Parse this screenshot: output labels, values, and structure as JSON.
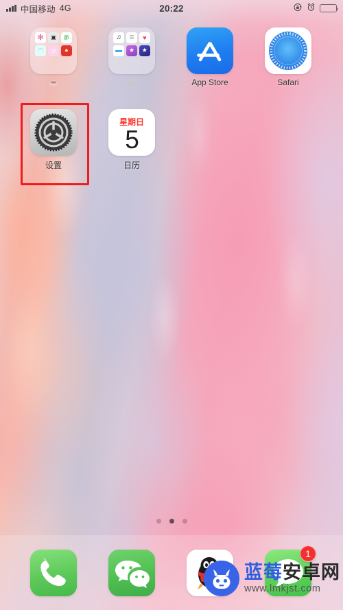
{
  "status_bar": {
    "carrier": "中国移动",
    "network": "4G",
    "time": "20:22",
    "signal_icon": "signal-bars-icon",
    "rotation_lock_icon": "rotation-lock-icon",
    "alarm_icon": "alarm-clock-icon",
    "battery_icon": "battery-full-icon"
  },
  "home_screen": {
    "rows": [
      {
        "items": [
          {
            "type": "folder",
            "name": "folder-photos-camera",
            "label": "",
            "mini_apps": [
              {
                "name": "photos-app",
                "glyph": "❋",
                "bg": "#ffffff",
                "fg": "#e8457c"
              },
              {
                "name": "camera-app",
                "glyph": "📷",
                "bg": "#efefef",
                "fg": "#3a3a3a"
              },
              {
                "name": "chinese-text-app",
                "glyph": "節",
                "bg": "#f4fff6",
                "fg": "#2f9e5a"
              },
              {
                "name": "white-face-app",
                "glyph": "◠",
                "bg": "#e6fbfb",
                "fg": "#6fd0cf"
              },
              {
                "name": "meitu-camera-app",
                "glyph": "⊙",
                "bg": "#ffd9ec",
                "fg": "#ffffff"
              },
              {
                "name": "red-cartoon-app",
                "glyph": "♣",
                "bg": "#e83b3b",
                "fg": "#ffffff"
              }
            ]
          },
          {
            "type": "folder",
            "name": "folder-media-tools",
            "label": "",
            "mini_apps": [
              {
                "name": "music-app",
                "glyph": "♫",
                "bg": "#ffffff",
                "fg": "#3a3a3a"
              },
              {
                "name": "reminders-app",
                "glyph": "☰",
                "bg": "#fbfbfb",
                "fg": "#8a8a8a"
              },
              {
                "name": "health-app",
                "glyph": "♥",
                "bg": "#ffffff",
                "fg": "#f0375a"
              },
              {
                "name": "files-app",
                "glyph": "▭",
                "bg": "#ffffff",
                "fg": "#4aa8ea"
              },
              {
                "name": "imovie-app",
                "glyph": "★",
                "bg": "#a94fd4",
                "fg": "#ffffff"
              },
              {
                "name": "itunes-app",
                "glyph": "★",
                "bg": "#2b2a8e",
                "fg": "#ffffff"
              }
            ]
          },
          {
            "type": "app",
            "name": "app-store",
            "label": "App Store",
            "icon": "app-store-icon"
          },
          {
            "type": "app",
            "name": "safari",
            "label": "Safari",
            "icon": "safari-compass-icon"
          }
        ]
      },
      {
        "items": [
          {
            "type": "app",
            "name": "settings",
            "label": "设置",
            "icon": "gear-icon",
            "highlighted": true
          },
          {
            "type": "app",
            "name": "calendar",
            "label": "日历",
            "icon": "calendar-icon",
            "calendar": {
              "weekday": "星期日",
              "day": "5"
            }
          },
          {
            "type": "empty",
            "name": "empty-slot",
            "label": ""
          },
          {
            "type": "empty",
            "name": "empty-slot",
            "label": ""
          }
        ]
      }
    ],
    "page_dots": {
      "count": 3,
      "active_index": 1
    }
  },
  "dock": {
    "items": [
      {
        "name": "phone-app",
        "icon": "phone-handset-icon",
        "badge": ""
      },
      {
        "name": "wechat-app",
        "icon": "wechat-bubbles-icon",
        "badge": ""
      },
      {
        "name": "qq-app",
        "icon": "qq-penguin-icon",
        "badge": ""
      },
      {
        "name": "messages-app",
        "icon": "message-bubble-icon",
        "badge": "1"
      }
    ]
  },
  "watermark": {
    "logo_icon": "android-robot-icon",
    "brand_blue": "蓝莓",
    "brand_dark": "安卓网",
    "url": "www.lmkjst.com",
    "accent_color": "#2f5fe0"
  },
  "annotation": {
    "highlight_color": "#ee1c1c",
    "target": "设置"
  }
}
